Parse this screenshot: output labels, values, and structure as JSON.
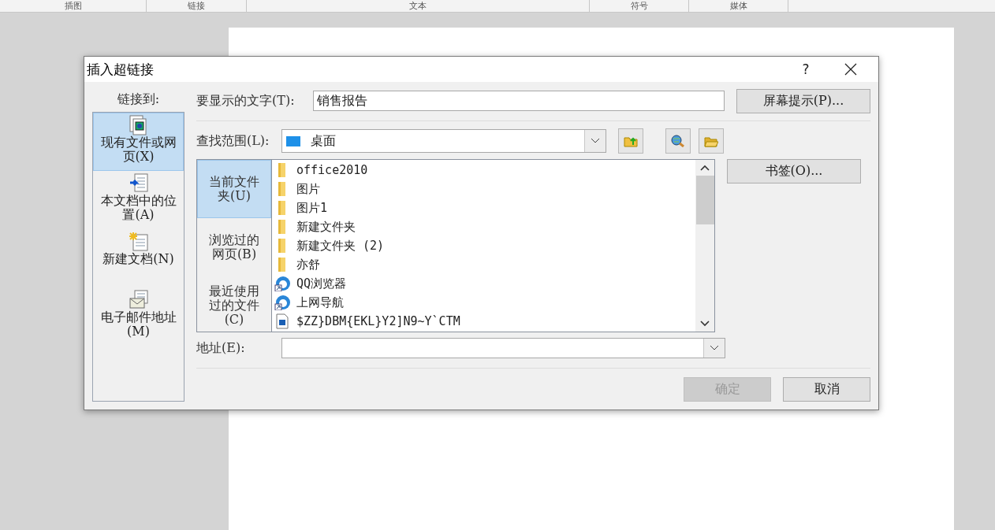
{
  "ribbon_groups": [
    {
      "label": "插图"
    },
    {
      "label": "链接"
    },
    {
      "label": "文本"
    },
    {
      "label": "符号"
    },
    {
      "label": "媒体"
    }
  ],
  "dialog": {
    "title": "插入超链接",
    "help": "?",
    "link_to": {
      "label": "链接到:",
      "items": [
        {
          "label": "现有文件或网页(X)",
          "selected": true,
          "kind": "file"
        },
        {
          "label": "本文档中的位置(A)",
          "selected": false,
          "kind": "place"
        },
        {
          "label": "新建文档(N)",
          "selected": false,
          "kind": "new"
        },
        {
          "label": "电子邮件地址(M)",
          "selected": false,
          "kind": "mail"
        }
      ]
    },
    "display_text": {
      "label": "要显示的文字(T):",
      "value": "销售报告"
    },
    "screen_tip_button": "屏幕提示(P)...",
    "look_in": {
      "label": "查找范围(L):",
      "value": "桌面"
    },
    "places": [
      {
        "label": "当前文件夹(U)",
        "selected": true
      },
      {
        "label": "浏览过的网页(B)",
        "selected": false
      },
      {
        "label": "最近使用过的文件(C)",
        "selected": false
      }
    ],
    "files": [
      {
        "name": "office2010",
        "kind": "folder"
      },
      {
        "name": "图片",
        "kind": "folder"
      },
      {
        "name": "图片1",
        "kind": "folder"
      },
      {
        "name": "新建文件夹",
        "kind": "folder"
      },
      {
        "name": "新建文件夹 (2)",
        "kind": "folder"
      },
      {
        "name": "亦舒",
        "kind": "folder"
      },
      {
        "name": "QQ浏览器",
        "kind": "browser"
      },
      {
        "name": "上网导航",
        "kind": "browser"
      },
      {
        "name": "$ZZ}DBM{EKL}Y2]N9~Y`CTM",
        "kind": "image"
      }
    ],
    "bookmark_button": "书签(O)...",
    "address": {
      "label": "地址(E):"
    },
    "buttons": [
      {
        "label": "确定",
        "disabled": true
      },
      {
        "label": "取消",
        "disabled": false
      }
    ]
  }
}
